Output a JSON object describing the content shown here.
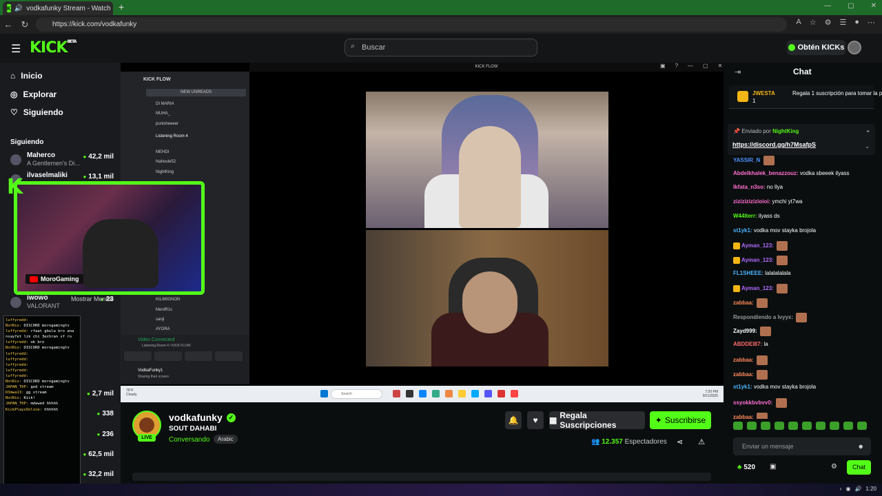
{
  "browser": {
    "tab_title": "vodkafunky Stream - Watch",
    "url": "https://kick.com/vodkafunky"
  },
  "header": {
    "logo": "KICK",
    "logo_sup": "BETA",
    "search_placeholder": "Buscar",
    "get_kicks": "Obtén KICKs"
  },
  "sidebar": {
    "nav": [
      {
        "label": "Inicio",
        "icon": "home-icon"
      },
      {
        "label": "Explorar",
        "icon": "compass-icon"
      },
      {
        "label": "Siguiendo",
        "icon": "heart-icon"
      }
    ],
    "following_title": "Siguiendo",
    "following": [
      {
        "name": "Maherco",
        "sub": "A Gentlemen's Di...",
        "viewers": "42,2 mil"
      },
      {
        "name": "ilvaselmaliki",
        "sub": "",
        "viewers": "13,1 mil"
      },
      {
        "name": "iwowo",
        "sub": "VALORANT",
        "viewers": "23"
      }
    ],
    "show_less": "Mostrar Menos",
    "recommended_viewers": [
      "2,7 mil",
      "338",
      "236",
      "62,5 mil",
      "32,2 mil"
    ]
  },
  "discord": {
    "server": "KICK FLOW",
    "new_unreads": "NEW UNREADS",
    "channels": [
      "DI MARIA",
      "MUHA_",
      "punisheeeer",
      "Listening Room 4",
      "MEHDI",
      "Nahoule52",
      "NightKing",
      "KILIMIGNON",
      "MentR1s",
      "sanji",
      "AYORA"
    ],
    "voice_status": "Video Connected",
    "voice_channel": "Listening Room 4 / KICK FLOW",
    "user": "VodkaFunky1",
    "user_status": "Sharing their screen"
  },
  "webcam": {
    "label": "MoroGaming"
  },
  "overlay_chat": [
    {
      "u": "luffyredd:",
      "m": ""
    },
    {
      "u": "BotRix:",
      "m": "DISCORD morogamingtv"
    },
    {
      "u": "luffyredd:",
      "m": "rfaat gbula bro ana nsayfet lik chi 3echran sf ro"
    },
    {
      "u": "luffyredd:",
      "m": "ok bro"
    },
    {
      "u": "BotRix:",
      "m": "DISCORD morogamingtv"
    },
    {
      "u": "luffyredd:",
      "m": ""
    },
    {
      "u": "luffyredd:",
      "m": ""
    },
    {
      "u": "luffyredd:",
      "m": ""
    },
    {
      "u": "luffyredd:",
      "m": ""
    },
    {
      "u": "luffyredd:",
      "m": ""
    },
    {
      "u": "BotRix:",
      "m": "DISCORD morogamingtv"
    },
    {
      "u": "JAPAN_T0P:",
      "m": "god stream"
    },
    {
      "u": "D3mwa13:",
      "m": "gg stream"
    },
    {
      "u": "BotRix:",
      "m": "Kick!"
    },
    {
      "u": "JAPAN_T0P:",
      "m": "mdawed hhhhh"
    },
    {
      "u": "KickPlaysOnline:",
      "m": "hhhhhh"
    }
  ],
  "player": {
    "window_title": "KICK FLOW"
  },
  "taskbar": {
    "weather_temp": "76°F",
    "weather": "Cloudy",
    "search": "Search",
    "time": "7:20 PM",
    "date": "9/21/2025"
  },
  "channel": {
    "name": "vodkafunky",
    "title": "SOUT DAHABI",
    "category": "Conversando",
    "tag": "Arabic",
    "live": "LIVE",
    "gift_subs": "Regala Suscripciones",
    "subscribe": "Suscribirse",
    "viewers": "12.357",
    "viewers_label": "Espectadores"
  },
  "chat": {
    "title": "Chat",
    "gift_user": "JWESTA",
    "gift_count": "1",
    "gift_msg": "Regala 1 suscripción para tomar la posición 2",
    "pinned_by_prefix": "Enviado por",
    "pinned_by": "NightKing",
    "pinned_link": "https://discord.gg/h7MsafpS",
    "messages": [
      {
        "u": "YASSIR_N",
        "m": "",
        "c": "#4a90ff"
      },
      {
        "u": "Abdelkhalek_benazzouz:",
        "m": "vodka sbeeek ilyass",
        "c": "#ff6fd0"
      },
      {
        "u": "lkfata_n3so:",
        "m": "no llya",
        "c": "#ff6fd0"
      },
      {
        "u": "zizizizizizioioi:",
        "m": "ymchi yt7wa",
        "c": "#ff6fd0"
      },
      {
        "u": "W44lterr:",
        "m": "ilyass ds",
        "c": "#53fc18"
      },
      {
        "u": "st1yk1:",
        "m": "vodka mov stayka brojola",
        "c": "#4ab4ff"
      },
      {
        "u": "Ayman_123:",
        "m": "",
        "c": "#b06aff"
      },
      {
        "u": "Ayman_123:",
        "m": "",
        "c": "#b06aff"
      },
      {
        "u": "FL1SHEEE:",
        "m": "lalalalalala",
        "c": "#4ab4ff"
      },
      {
        "u": "Ayman_123:",
        "m": "",
        "c": "#b06aff"
      },
      {
        "u": "zabbaa:",
        "m": "",
        "c": "#ff8a5a"
      },
      {
        "u": "Respondiendo a lvyyx:",
        "m": "",
        "c": "#999"
      },
      {
        "u": "Zayd999:",
        "m": "",
        "c": "#fff"
      },
      {
        "u": "ABDDEI87:",
        "m": "la",
        "c": "#ff6a6a"
      },
      {
        "u": "zabbaa:",
        "m": "",
        "c": "#ff8a5a"
      },
      {
        "u": "zabbaa:",
        "m": "",
        "c": "#ff8a5a"
      },
      {
        "u": "st1yk1:",
        "m": "vodka mov stayka brojola",
        "c": "#4ab4ff"
      },
      {
        "u": "ssyokkbvbvv0:",
        "m": "",
        "c": "#ff6fd0"
      },
      {
        "u": "zabbaa:",
        "m": "",
        "c": "#ff8a5a"
      }
    ],
    "input_placeholder": "Enviar un mensaje",
    "points": "520",
    "send": "Chat"
  },
  "system": {
    "clock": "1:20"
  },
  "colors": {
    "accent": "#53fc18",
    "background": "#0b0e0f"
  }
}
